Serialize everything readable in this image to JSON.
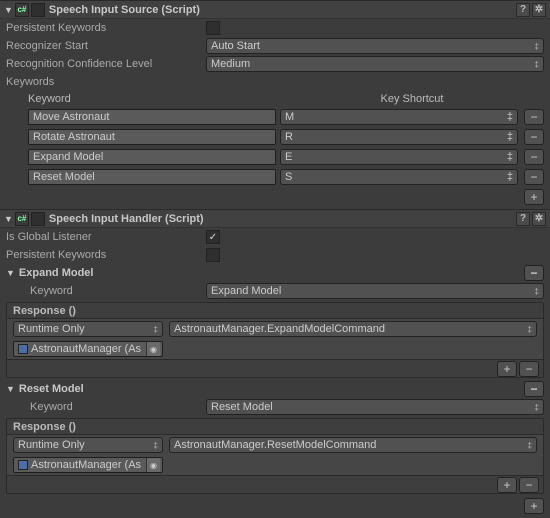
{
  "components": {
    "speechSource": {
      "title": "Speech Input Source (Script)",
      "enabled": false,
      "persistentKeywordsLabel": "Persistent Keywords",
      "persistentKeywords": false,
      "recognizerStartLabel": "Recognizer Start",
      "recognizerStart": "Auto Start",
      "confidenceLabel": "Recognition Confidence Level",
      "confidence": "Medium",
      "keywordsLabel": "Keywords",
      "keywordCol": "Keyword",
      "shortcutCol": "Key Shortcut",
      "keywords": [
        {
          "name": "Move Astronaut",
          "key": "M"
        },
        {
          "name": "Rotate Astronaut",
          "key": "R"
        },
        {
          "name": "Expand Model",
          "key": "E"
        },
        {
          "name": "Reset Model",
          "key": "S"
        }
      ]
    },
    "speechHandler": {
      "title": "Speech Input Handler (Script)",
      "enabled": false,
      "globalListenerLabel": "Is Global Listener",
      "globalListener": true,
      "persistentKeywordsLabel": "Persistent Keywords",
      "persistentKeywords": false,
      "sections": {
        "expand": {
          "title": "Expand Model",
          "keywordLabel": "Keyword",
          "keyword": "Expand Model",
          "responseLabel": "Response ()",
          "runtime": "Runtime Only",
          "method": "AstronautManager.ExpandModelCommand",
          "target": "AstronautManager (As"
        },
        "reset": {
          "title": "Reset Model",
          "keywordLabel": "Keyword",
          "keyword": "Reset Model",
          "responseLabel": "Response ()",
          "runtime": "Runtime Only",
          "method": "AstronautManager.ResetModelCommand",
          "target": "AstronautManager (As"
        }
      }
    }
  },
  "icons": {
    "plus": "+",
    "minus": "−",
    "gear": "✲",
    "help": "?",
    "check": "✓",
    "obj": "◉",
    "triDown": "▼",
    "triRight": "▶",
    "ddArrow": "‡"
  }
}
